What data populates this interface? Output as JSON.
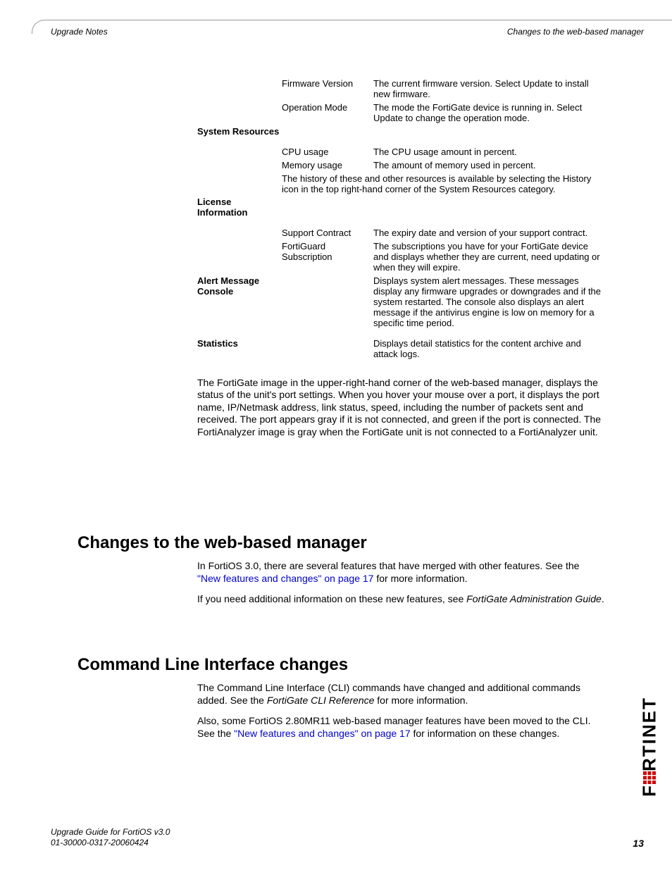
{
  "header": {
    "left": "Upgrade Notes",
    "right": "Changes to the web-based manager"
  },
  "table": {
    "firmware_version": {
      "label": "Firmware Version",
      "desc": "The current firmware version. Select Update to install new firmware."
    },
    "operation_mode": {
      "label": "Operation Mode",
      "desc": "The mode the FortiGate device is running in. Select Update to change the operation mode."
    },
    "system_resources": {
      "h": "System Resources"
    },
    "cpu_usage": {
      "label": "CPU usage",
      "desc": "The CPU usage amount in percent."
    },
    "memory_usage": {
      "label": "Memory usage",
      "desc": "The amount of memory used in percent."
    },
    "history_note": "The history of these and other resources is available by selecting the History icon in the top right-hand corner of the System Resources category.",
    "license_info": {
      "h": "License Information"
    },
    "support_contract": {
      "label": "Support Contract",
      "desc": "The expiry date and version of your support contract."
    },
    "fortiguard": {
      "label": "FortiGuard Subscription",
      "desc": "The subscriptions you have for your FortiGate device and displays whether they are current, need updating or when they will expire."
    },
    "alert_console": {
      "h": "Alert Message Console",
      "desc": "Displays system alert messages. These messages display any firmware upgrades or downgrades and if the system restarted. The console also displays an alert message if the antivirus engine is low on memory for a specific time period."
    },
    "statistics": {
      "h": "Statistics",
      "desc": "Displays detail statistics for the content archive and attack logs."
    }
  },
  "post_table_para": "The FortiGate image in the upper-right-hand corner of the web-based manager, displays the status of the unit's port settings. When you hover your mouse over a port, it displays the port name, IP/Netmask address, link status, speed, including the number of packets sent and received. The port appears gray if it is not connected, and green if the port is connected. The FortiAnalyzer image is gray when the FortiGate unit is not connected to a FortiAnalyzer unit.",
  "section1": {
    "heading": "Changes to the web-based manager",
    "p1_pre": "In FortiOS 3.0, there are several features that have merged with other features. See the ",
    "p1_link": "\"New features and changes\" on page 17",
    "p1_post": " for more information.",
    "p2_pre": "If you need additional information on these new features, see ",
    "p2_em": "FortiGate Administration Guide",
    "p2_post": "."
  },
  "section2": {
    "heading": "Command Line Interface changes",
    "p1_pre": "The Command Line Interface (CLI) commands have changed and additional commands added. See the ",
    "p1_em": "FortiGate CLI Reference",
    "p1_post": " for more information.",
    "p2_pre": "Also, some FortiOS 2.80MR11 web-based manager features have been moved to the CLI. See the ",
    "p2_link": "\"New features and changes\" on page 17",
    "p2_post": " for information on these changes."
  },
  "footer": {
    "line1": "Upgrade Guide for FortiOS v3.0",
    "line2": "01-30000-0317-20060424",
    "page": "13"
  },
  "logo_text": "F    RTINET"
}
